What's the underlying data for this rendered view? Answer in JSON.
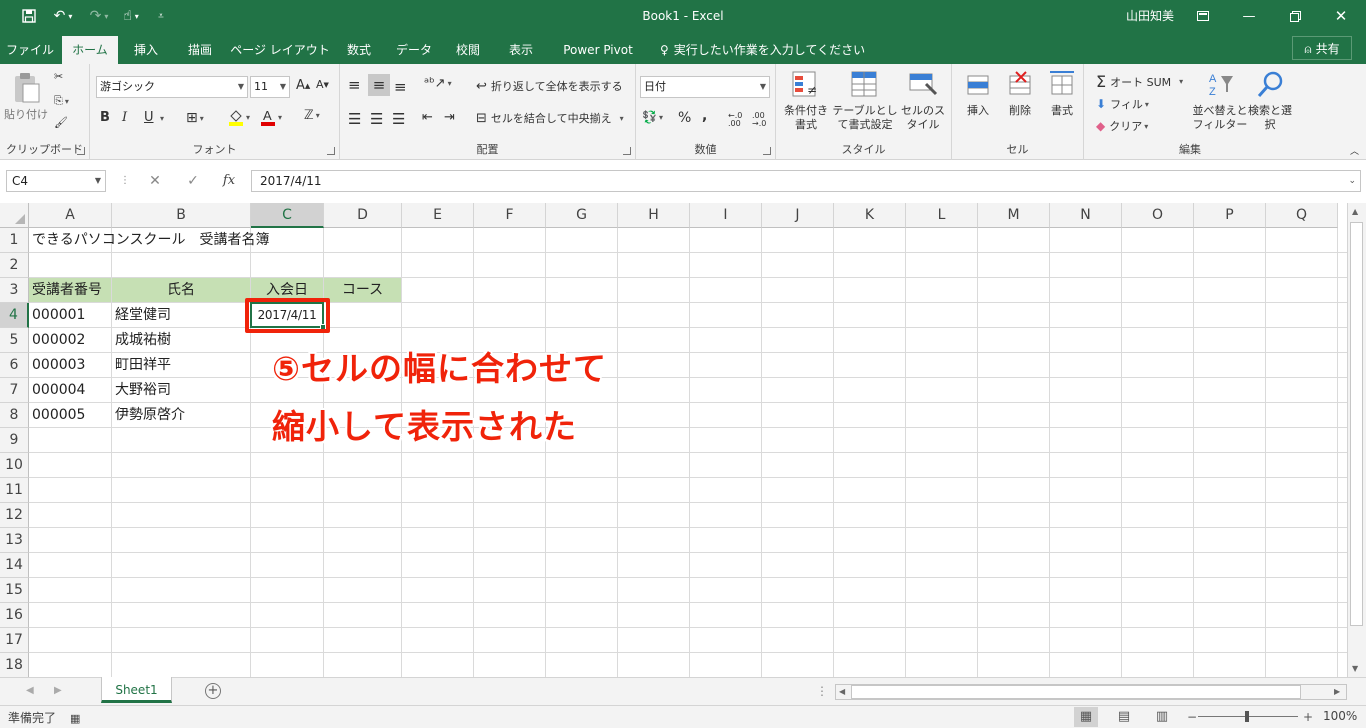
{
  "window": {
    "title": "Book1 - Excel",
    "user": "山田知美"
  },
  "ribbon_tabs": [
    {
      "label": "ファイル"
    },
    {
      "label": "ホーム"
    },
    {
      "label": "挿入"
    },
    {
      "label": "描画"
    },
    {
      "label": "ページ レイアウト"
    },
    {
      "label": "数式"
    },
    {
      "label": "データ"
    },
    {
      "label": "校閲"
    },
    {
      "label": "表示"
    },
    {
      "label": "Power Pivot"
    }
  ],
  "tell_me": "実行したい作業を入力してください",
  "share_label": "共有",
  "ribbon": {
    "clipboard": {
      "paste": "貼り付け",
      "label": "クリップボード"
    },
    "font": {
      "name": "游ゴシック",
      "size": "11",
      "bold": "B",
      "italic": "I",
      "underline": "U",
      "label": "フォント"
    },
    "alignment": {
      "wrap": "折り返して全体を表示する",
      "merge": "セルを結合して中央揃え",
      "label": "配置"
    },
    "number": {
      "format": "日付",
      "label": "数値"
    },
    "styles": {
      "conditional": "条件付き書式",
      "table": "テーブルとして書式設定",
      "cell": "セルのスタイル",
      "label": "スタイル"
    },
    "cells": {
      "insert": "挿入",
      "delete": "削除",
      "format": "書式",
      "label": "セル"
    },
    "editing": {
      "autosum": "オート SUM",
      "fill": "フィル",
      "clear": "クリア",
      "sort": "並べ替えとフィルター",
      "find": "検索と選択",
      "label": "編集"
    }
  },
  "formula_bar": {
    "name_box": "C4",
    "value": "2017/4/11"
  },
  "columns": [
    "A",
    "B",
    "C",
    "D",
    "E",
    "F",
    "G",
    "H",
    "I",
    "J",
    "K",
    "L",
    "M",
    "N",
    "O",
    "P",
    "Q"
  ],
  "rows": [
    "1",
    "2",
    "3",
    "4",
    "5",
    "6",
    "7",
    "8",
    "9",
    "10",
    "11",
    "12",
    "13",
    "14",
    "15",
    "16",
    "17",
    "18"
  ],
  "cells": {
    "A1": "できるパソコンスクール　受講者名簿",
    "A3": "受講者番号",
    "B3": "氏名",
    "C3": "入会日",
    "D3": "コース",
    "A4": "000001",
    "B4": "経堂健司",
    "C4": "2017/4/11",
    "A5": "000002",
    "B5": "成城祐樹",
    "A6": "000003",
    "B6": "町田祥平",
    "A7": "000004",
    "B7": "大野裕司",
    "A8": "000005",
    "B8": "伊勢原啓介"
  },
  "annotation": {
    "line1": "⑤セルの幅に合わせて",
    "line2": "縮小して表示された",
    "color": "#f0230a"
  },
  "sheet_tab": "Sheet1",
  "status": "準備完了",
  "zoom": "100%",
  "colors": {
    "excel_green": "#217346",
    "header_fill": "#c6e0b4"
  }
}
